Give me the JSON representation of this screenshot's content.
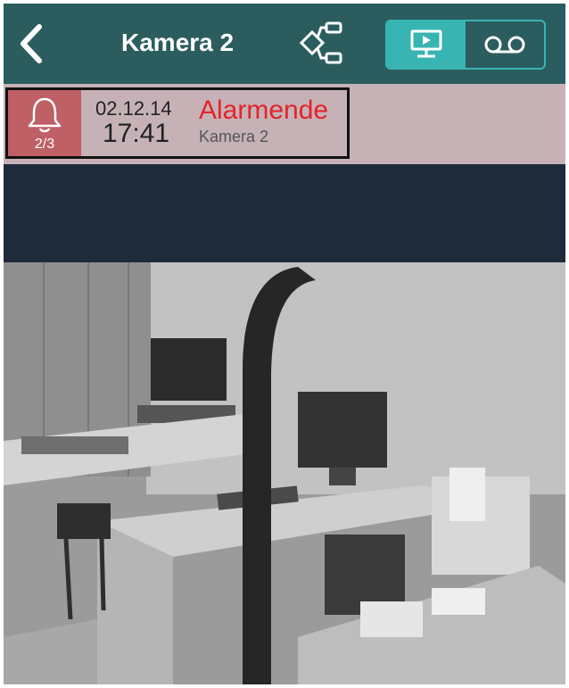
{
  "header": {
    "title": "Kamera 2",
    "back_icon": "chevron-left-icon",
    "tree_icon": "hierarchy-icon",
    "view_toggle": [
      {
        "name": "live",
        "icon": "monitor-play-icon",
        "active": true
      },
      {
        "name": "recordings",
        "icon": "tape-icon",
        "active": false
      }
    ]
  },
  "alarm": {
    "count": "2/3",
    "date": "02.12.14",
    "time": "17:41",
    "title": "Alarmende",
    "camera": "Kamera 2"
  },
  "colors": {
    "header_bg": "#2b5d5e",
    "accent": "#38b4b2",
    "alarm_strip_bg": "#c6b2b6",
    "alarm_icon_bg": "#bf5f66",
    "alarm_red": "#e4222a",
    "dark_band": "#1f2b3a"
  }
}
